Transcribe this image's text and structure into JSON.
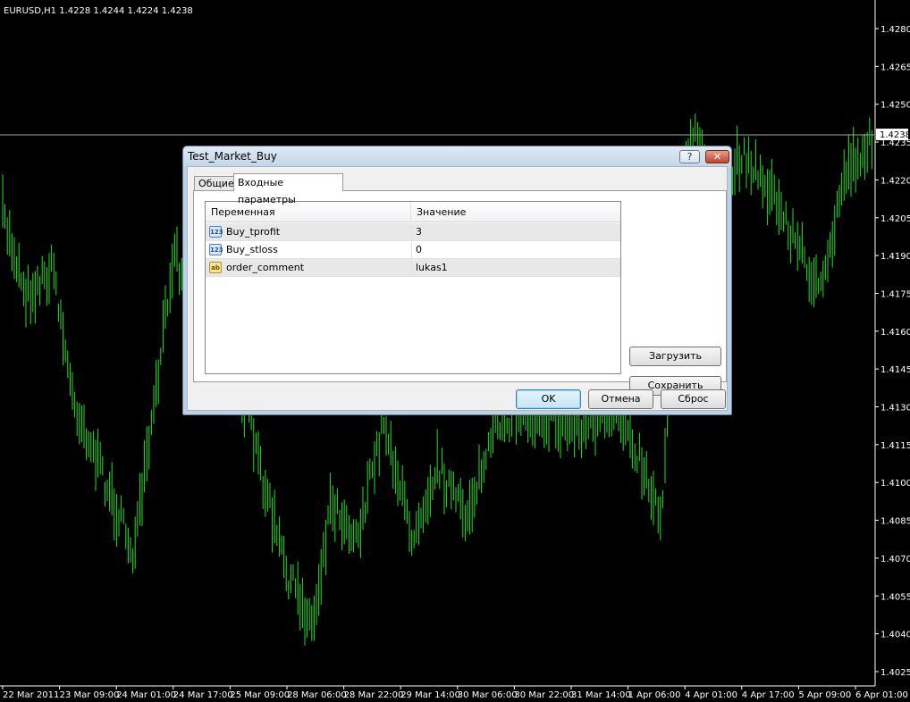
{
  "chart": {
    "symbol_info": "EURUSD,H1  1.4228 1.4244 1.4224 1.4238",
    "current_price": "1.4238",
    "price_axis": [
      "1.4280",
      "1.4265",
      "1.4250",
      "1.4235",
      "1.4220",
      "1.4205",
      "1.4190",
      "1.4175",
      "1.4160",
      "1.4145",
      "1.4130",
      "1.4115",
      "1.4100",
      "1.4085",
      "1.4070",
      "1.4055",
      "1.4040",
      "1.4025"
    ],
    "time_axis": [
      "22 Mar 2011",
      "23 Mar 09:00",
      "24 Mar 01:00",
      "24 Mar 17:00",
      "25 Mar 09:00",
      "28 Mar 06:00",
      "28 Mar 22:00",
      "29 Mar 14:00",
      "30 Mar 06:00",
      "30 Mar 22:00",
      "31 Mar 14:00",
      "1 Apr 06:00",
      "4 Apr 01:00",
      "4 Apr 17:00",
      "5 Apr 09:00",
      "6 Apr 01:00"
    ],
    "colors": {
      "background": "#000000",
      "bars": "#19e619",
      "text": "#ffffff",
      "price_line": "#9aaea0"
    }
  },
  "dialog": {
    "title": "Test_Market_Buy",
    "help_label": "?",
    "close_label": "✕",
    "tabs": {
      "general": "Общие",
      "inputs": "Входные параметры"
    },
    "table": {
      "headers": {
        "variable": "Переменная",
        "value": "Значение"
      },
      "rows": [
        {
          "icon": "123",
          "name": "Buy_tprofit",
          "value": "3"
        },
        {
          "icon": "123",
          "name": "Buy_stloss",
          "value": "0"
        },
        {
          "icon": "ab",
          "name": "order_comment",
          "value": "lukas1"
        }
      ]
    },
    "buttons": {
      "load": "Загрузить",
      "save": "Сохранить",
      "ok": "OK",
      "cancel": "Отмена",
      "reset": "Сброс"
    }
  }
}
